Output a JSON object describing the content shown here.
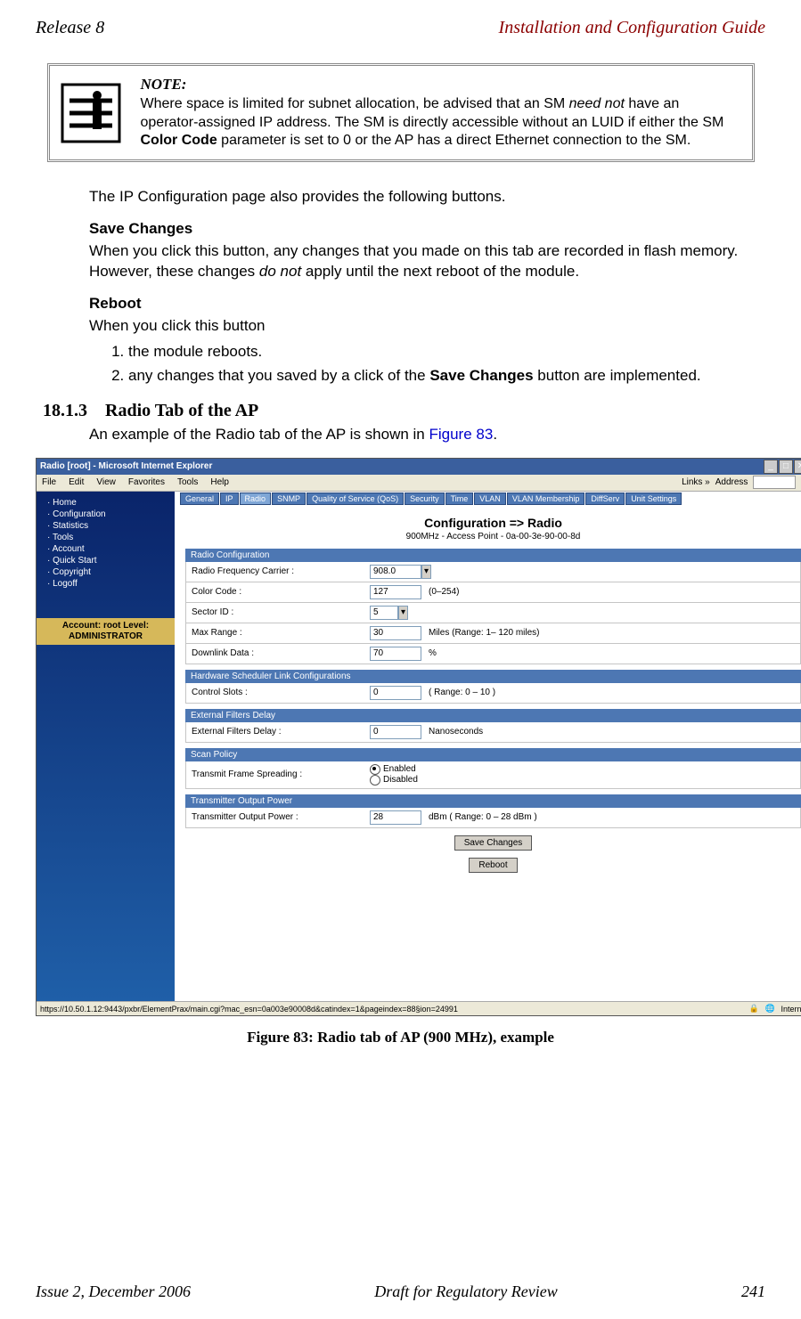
{
  "header": {
    "left": "Release 8",
    "right": "Installation and Configuration Guide"
  },
  "note": {
    "title": "NOTE:",
    "text_before": "Where space is limited for subnet allocation, be advised that an SM ",
    "em1": "need not",
    "text_mid": " have an operator-assigned IP address. The SM is directly accessible without an LUID if either the SM ",
    "b1": "Color Code",
    "text_after": " parameter is set to 0 or the AP has a direct Ethernet connection to the SM."
  },
  "para1": "The IP Configuration page also provides the following buttons.",
  "save_changes": {
    "head": "Save Changes",
    "body_before": "When you click this button, any changes that you made on this tab are recorded in flash memory. However, these changes ",
    "em": "do not",
    "body_after": " apply until the next reboot of the module."
  },
  "reboot": {
    "head": "Reboot",
    "intro": "When you click this button",
    "steps": [
      "the module reboots.",
      {
        "pre": "any changes that you saved by a click of the ",
        "b": "Save Changes",
        "post": " button are implemented."
      }
    ]
  },
  "section": {
    "num": "18.1.3",
    "title": "Radio Tab of the AP"
  },
  "sec_para_before": "An example of the Radio tab of the AP is shown in ",
  "sec_link": "Figure 83",
  "sec_para_after": ".",
  "screenshot": {
    "win_title": "Radio [root] - Microsoft Internet Explorer",
    "menus": [
      "File",
      "Edit",
      "View",
      "Favorites",
      "Tools",
      "Help"
    ],
    "links_label": "Links »",
    "addr_label": "Address",
    "sidebar_items": [
      "Home",
      "Configuration",
      "Statistics",
      "Tools",
      "Account",
      "Quick Start",
      "Copyright",
      "Logoff"
    ],
    "sidebar_account": "Account: root\nLevel: ADMINISTRATOR",
    "tabs": [
      "General",
      "IP",
      "Radio",
      "SNMP",
      "Quality of Service (QoS)",
      "Security",
      "Time",
      "VLAN",
      "VLAN Membership",
      "DiffServ",
      "Unit Settings"
    ],
    "main_heading": "Configuration => Radio",
    "main_sub": "900MHz - Access Point - 0a-00-3e-90-00-8d",
    "rc_head": "Radio Configuration",
    "rc_freq_label": "Radio Frequency Carrier :",
    "rc_freq_val": "908.0",
    "rc_color_label": "Color Code :",
    "rc_color_val": "127",
    "rc_color_hint": "(0–254)",
    "rc_sector_label": "Sector ID :",
    "rc_sector_val": "5",
    "rc_max_label": "Max Range :",
    "rc_max_val": "30",
    "rc_max_hint": "Miles (Range: 1– 120  miles)",
    "rc_down_label": "Downlink Data :",
    "rc_down_val": "70",
    "rc_down_hint": "%",
    "hs_head": "Hardware Scheduler Link Configurations",
    "hs_label": "Control Slots :",
    "hs_val": "0",
    "hs_hint": "( Range: 0 – 10 )",
    "ef_head": "External Filters Delay",
    "ef_label": "External Filters Delay :",
    "ef_val": "0",
    "ef_hint": "Nanoseconds",
    "sp_head": "Scan Policy",
    "sp_label": "Transmit Frame Spreading :",
    "sp_on": "Enabled",
    "sp_off": "Disabled",
    "tx_head": "Transmitter Output Power",
    "tx_label": "Transmitter Output Power :",
    "tx_val": "28",
    "tx_hint": "dBm ( Range: 0 – 28  dBm )",
    "btn_save": "Save Changes",
    "btn_reboot": "Reboot",
    "status_url": "https://10.50.1.12:9443/pxbr/ElementPrax/main.cgi?mac_esn=0a003e90008d&catindex=1&pageindex=88§ion=24991",
    "status_zone": "Internet"
  },
  "caption": "Figure 83: Radio tab of AP (900 MHz), example",
  "footer": {
    "left": "Issue 2, December 2006",
    "mid": "Draft for Regulatory Review",
    "right": "241"
  }
}
